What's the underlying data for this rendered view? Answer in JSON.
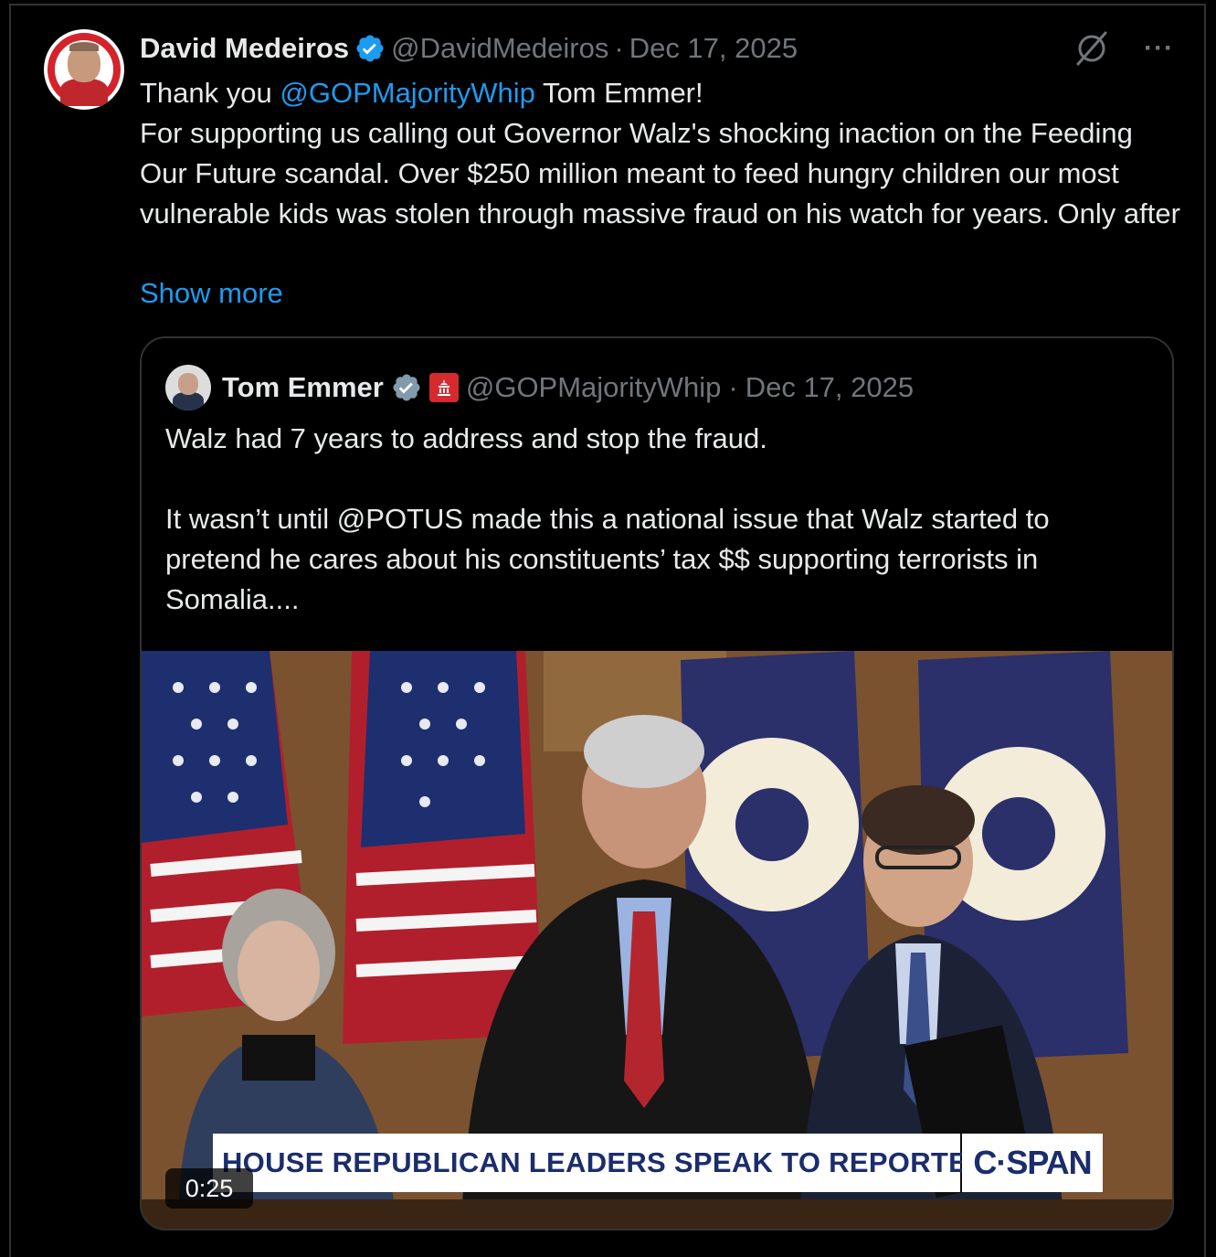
{
  "tweet": {
    "author_name": "David Medeiros",
    "handle": "@DavidMedeiros",
    "separator": "·",
    "date": "Dec 17, 2025",
    "text_prefix": "Thank you ",
    "mention": "@GOPMajorityWhip",
    "text_after_mention": " Tom Emmer!",
    "text_body": "For supporting us calling out Governor Walz's shocking inaction on the Feeding Our Future scandal. Over $250 million meant to feed hungry children our most vulnerable kids was stolen through massive fraud on his watch for years. Only after",
    "show_more": "Show more",
    "icons": {
      "grok": "grok-icon",
      "more": "more-icon",
      "verified": "verified-badge-icon"
    }
  },
  "quote": {
    "author_name": "Tom Emmer",
    "handle": "@GOPMajorityWhip",
    "separator": "·",
    "date": "Dec 17, 2025",
    "text": "Walz had 7 years to address and stop the fraud.\n\nIt wasn’t until @POTUS made this a national issue that Walz started to pretend he cares about his constituents’ tax $$ supporting terrorists in Somalia....",
    "video": {
      "chyron": "HOUSE REPUBLICAN LEADERS SPEAK TO REPORTERS",
      "network": "C·SPAN",
      "duration": "0:25"
    },
    "icons": {
      "verified": "verified-badge-icon",
      "affiliate": "capitol-icon"
    }
  },
  "colors": {
    "background": "#000000",
    "text": "#e7e9ea",
    "muted": "#71767b",
    "link": "#1d9bf0",
    "border": "#2f3336"
  }
}
